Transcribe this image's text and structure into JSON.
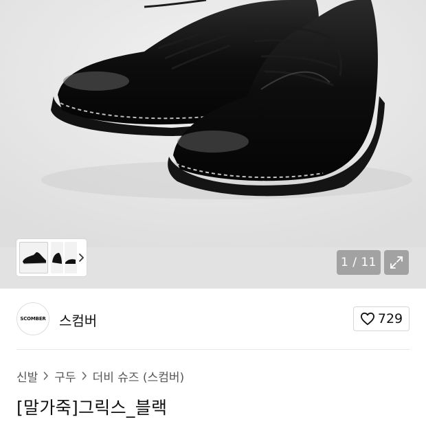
{
  "gallery": {
    "counter_text": "1 / 11",
    "thumbnail_count_visible": 3,
    "background_color": "#e6e6e6"
  },
  "brand": {
    "logo_text": "SCOMBER",
    "name": "스컴버",
    "like_count": "729"
  },
  "breadcrumb": {
    "items": [
      "신발",
      "구두",
      "더비 슈즈 (스컴버)"
    ],
    "separator_icon": "chevron-right-icon"
  },
  "product": {
    "title": "[말가죽]그릭스_블랙"
  },
  "icons": {
    "like": "heart-outline-icon",
    "expand": "expand-arrows-icon",
    "thumb_next": "chevron-right-icon"
  }
}
